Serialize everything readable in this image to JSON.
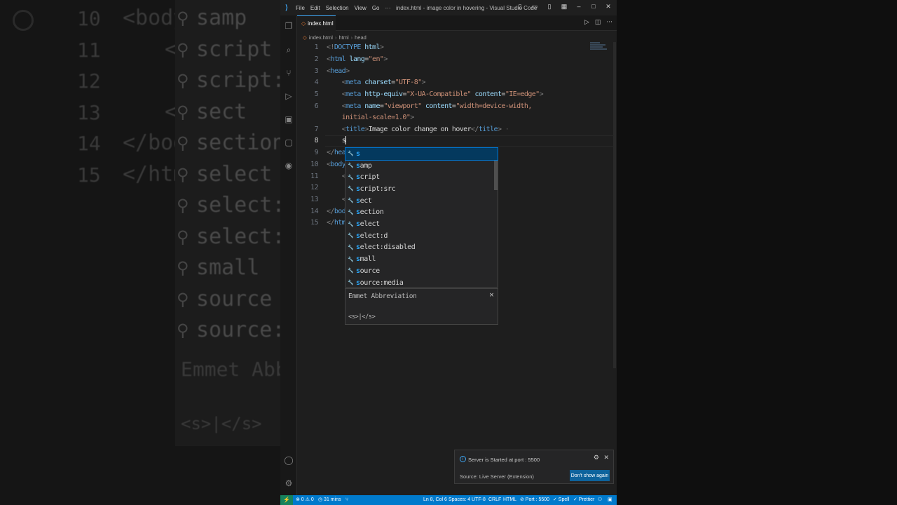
{
  "backdrop": {
    "line_numbers": [
      "10",
      "11",
      "12",
      "13",
      "14",
      "15"
    ],
    "code_lines": [
      "<body",
      "<",
      "",
      "<",
      "</bod",
      "</htm"
    ],
    "list": [
      "samp",
      "script",
      "script:s",
      "sect",
      "section",
      "select",
      "select:d",
      "select:d",
      "small",
      "source",
      "source:m"
    ],
    "detail_title": "Emmet Abbr",
    "detail_body": "<s>|</s>"
  },
  "titlebar": {
    "menus": [
      "File",
      "Edit",
      "Selection",
      "View",
      "Go",
      "···"
    ],
    "title": "index.html - image color in hovering - Visual Studio Code"
  },
  "tab": {
    "label": "index.html"
  },
  "breadcrumb": [
    "index.html",
    "html",
    "head"
  ],
  "editor": {
    "lines": [
      {
        "n": "1",
        "html": "<span class='p'>&lt;!</span><span class='t'>DOCTYPE</span> <span class='a'>html</span><span class='p'>&gt;</span>"
      },
      {
        "n": "2",
        "html": "<span class='p'>&lt;</span><span class='t'>html</span> <span class='a'>lang</span>=<span class='s'>\"en\"</span><span class='p'>&gt;</span>"
      },
      {
        "n": "3",
        "html": "<span class='p'>&lt;</span><span class='t'>head</span><span class='p'>&gt;</span>"
      },
      {
        "n": "4",
        "html": "    <span class='p'>&lt;</span><span class='t'>meta</span> <span class='a'>charset</span>=<span class='s'>\"UTF-8\"</span><span class='p'>&gt;</span>"
      },
      {
        "n": "5",
        "html": "    <span class='p'>&lt;</span><span class='t'>meta</span> <span class='a'>http-equiv</span>=<span class='s'>\"X-UA-Compatible\"</span> <span class='a'>content</span>=<span class='s'>\"IE=edge\"</span><span class='p'>&gt;</span>"
      },
      {
        "n": "6",
        "html": "    <span class='p'>&lt;</span><span class='t'>meta</span> <span class='a'>name</span>=<span class='s'>\"viewport\"</span> <span class='a'>content</span>=<span class='s'>\"width=device-width,</span>"
      },
      {
        "n": "",
        "html": "    <span class='s'>initial-scale=1.0\"</span><span class='p'>&gt;</span>"
      },
      {
        "n": "7",
        "html": "    <span class='p'>&lt;</span><span class='t'>title</span><span class='p'>&gt;</span><span class='txt'>Image color change on hover</span><span class='p'>&lt;/</span><span class='t'>title</span><span class='p'>&gt;</span> <span class='ghost'>·</span>"
      },
      {
        "n": "8",
        "html": "    <span class='txt'>s</span><span class='cursor'></span>"
      },
      {
        "n": "9",
        "html": "<span class='p'>&lt;/</span><span class='t'>hea</span>"
      },
      {
        "n": "10",
        "html": "<span class='p'>&lt;</span><span class='t'>body</span>"
      },
      {
        "n": "11",
        "html": "    <span class='p'>&lt;</span>"
      },
      {
        "n": "12",
        "html": ""
      },
      {
        "n": "13",
        "html": "    <span class='p'>&lt;</span>"
      },
      {
        "n": "14",
        "html": "<span class='p'>&lt;/</span><span class='t'>bod</span>"
      },
      {
        "n": "15",
        "html": "<span class='p'>&lt;/</span><span class='t'>htm</span>"
      }
    ]
  },
  "suggest": {
    "items": [
      "s",
      "samp",
      "script",
      "script:src",
      "sect",
      "section",
      "select",
      "select:d",
      "select:disabled",
      "small",
      "source",
      "source:media"
    ],
    "selected": 0,
    "detail_title": "Emmet Abbreviation",
    "detail_close": "×",
    "detail_body": "<s>|</s>"
  },
  "notification": {
    "message": "Server is Started at port : 5500",
    "source": "Source: Live Server (Extension)",
    "button": "Don't show again"
  },
  "statusbar": {
    "problems": "⊗ 0 ⚠ 0",
    "time": "◷ 31 mins",
    "position": "Ln 8, Col 6",
    "spaces": "Spaces: 4",
    "encoding": "UTF-8",
    "eol": "CRLF",
    "language": "HTML",
    "port": "⊘ Port : 5500",
    "spell": "✓ Spell",
    "prettier": "✓ Prettier"
  },
  "colors": {
    "accent": "#007acc",
    "tag": "#569cd6",
    "attr": "#9cdcfe",
    "string": "#ce9178",
    "suggest_highlight": "#2aaaff"
  }
}
